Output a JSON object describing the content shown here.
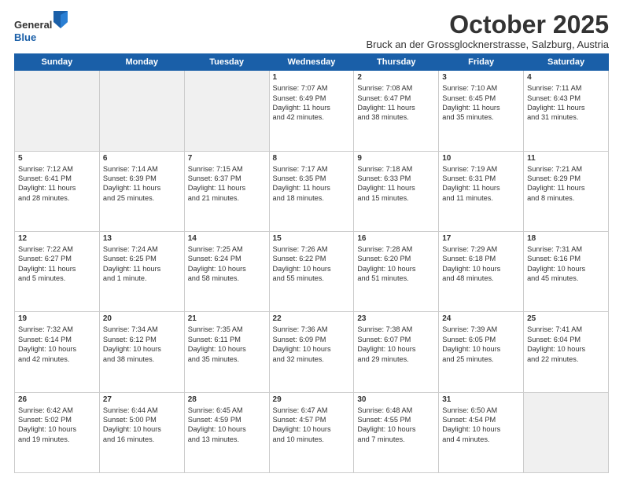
{
  "header": {
    "logo_line1": "General",
    "logo_line2": "Blue",
    "month": "October 2025",
    "location": "Bruck an der Grossglocknerstrasse, Salzburg, Austria"
  },
  "weekdays": [
    "Sunday",
    "Monday",
    "Tuesday",
    "Wednesday",
    "Thursday",
    "Friday",
    "Saturday"
  ],
  "rows": [
    [
      {
        "day": "",
        "info": "",
        "shaded": true
      },
      {
        "day": "",
        "info": "",
        "shaded": true
      },
      {
        "day": "",
        "info": "",
        "shaded": true
      },
      {
        "day": "1",
        "info": "Sunrise: 7:07 AM\nSunset: 6:49 PM\nDaylight: 11 hours\nand 42 minutes."
      },
      {
        "day": "2",
        "info": "Sunrise: 7:08 AM\nSunset: 6:47 PM\nDaylight: 11 hours\nand 38 minutes."
      },
      {
        "day": "3",
        "info": "Sunrise: 7:10 AM\nSunset: 6:45 PM\nDaylight: 11 hours\nand 35 minutes."
      },
      {
        "day": "4",
        "info": "Sunrise: 7:11 AM\nSunset: 6:43 PM\nDaylight: 11 hours\nand 31 minutes."
      }
    ],
    [
      {
        "day": "5",
        "info": "Sunrise: 7:12 AM\nSunset: 6:41 PM\nDaylight: 11 hours\nand 28 minutes."
      },
      {
        "day": "6",
        "info": "Sunrise: 7:14 AM\nSunset: 6:39 PM\nDaylight: 11 hours\nand 25 minutes."
      },
      {
        "day": "7",
        "info": "Sunrise: 7:15 AM\nSunset: 6:37 PM\nDaylight: 11 hours\nand 21 minutes."
      },
      {
        "day": "8",
        "info": "Sunrise: 7:17 AM\nSunset: 6:35 PM\nDaylight: 11 hours\nand 18 minutes."
      },
      {
        "day": "9",
        "info": "Sunrise: 7:18 AM\nSunset: 6:33 PM\nDaylight: 11 hours\nand 15 minutes."
      },
      {
        "day": "10",
        "info": "Sunrise: 7:19 AM\nSunset: 6:31 PM\nDaylight: 11 hours\nand 11 minutes."
      },
      {
        "day": "11",
        "info": "Sunrise: 7:21 AM\nSunset: 6:29 PM\nDaylight: 11 hours\nand 8 minutes."
      }
    ],
    [
      {
        "day": "12",
        "info": "Sunrise: 7:22 AM\nSunset: 6:27 PM\nDaylight: 11 hours\nand 5 minutes."
      },
      {
        "day": "13",
        "info": "Sunrise: 7:24 AM\nSunset: 6:25 PM\nDaylight: 11 hours\nand 1 minute."
      },
      {
        "day": "14",
        "info": "Sunrise: 7:25 AM\nSunset: 6:24 PM\nDaylight: 10 hours\nand 58 minutes."
      },
      {
        "day": "15",
        "info": "Sunrise: 7:26 AM\nSunset: 6:22 PM\nDaylight: 10 hours\nand 55 minutes."
      },
      {
        "day": "16",
        "info": "Sunrise: 7:28 AM\nSunset: 6:20 PM\nDaylight: 10 hours\nand 51 minutes."
      },
      {
        "day": "17",
        "info": "Sunrise: 7:29 AM\nSunset: 6:18 PM\nDaylight: 10 hours\nand 48 minutes."
      },
      {
        "day": "18",
        "info": "Sunrise: 7:31 AM\nSunset: 6:16 PM\nDaylight: 10 hours\nand 45 minutes."
      }
    ],
    [
      {
        "day": "19",
        "info": "Sunrise: 7:32 AM\nSunset: 6:14 PM\nDaylight: 10 hours\nand 42 minutes."
      },
      {
        "day": "20",
        "info": "Sunrise: 7:34 AM\nSunset: 6:12 PM\nDaylight: 10 hours\nand 38 minutes."
      },
      {
        "day": "21",
        "info": "Sunrise: 7:35 AM\nSunset: 6:11 PM\nDaylight: 10 hours\nand 35 minutes."
      },
      {
        "day": "22",
        "info": "Sunrise: 7:36 AM\nSunset: 6:09 PM\nDaylight: 10 hours\nand 32 minutes."
      },
      {
        "day": "23",
        "info": "Sunrise: 7:38 AM\nSunset: 6:07 PM\nDaylight: 10 hours\nand 29 minutes."
      },
      {
        "day": "24",
        "info": "Sunrise: 7:39 AM\nSunset: 6:05 PM\nDaylight: 10 hours\nand 25 minutes."
      },
      {
        "day": "25",
        "info": "Sunrise: 7:41 AM\nSunset: 6:04 PM\nDaylight: 10 hours\nand 22 minutes."
      }
    ],
    [
      {
        "day": "26",
        "info": "Sunrise: 6:42 AM\nSunset: 5:02 PM\nDaylight: 10 hours\nand 19 minutes."
      },
      {
        "day": "27",
        "info": "Sunrise: 6:44 AM\nSunset: 5:00 PM\nDaylight: 10 hours\nand 16 minutes."
      },
      {
        "day": "28",
        "info": "Sunrise: 6:45 AM\nSunset: 4:59 PM\nDaylight: 10 hours\nand 13 minutes."
      },
      {
        "day": "29",
        "info": "Sunrise: 6:47 AM\nSunset: 4:57 PM\nDaylight: 10 hours\nand 10 minutes."
      },
      {
        "day": "30",
        "info": "Sunrise: 6:48 AM\nSunset: 4:55 PM\nDaylight: 10 hours\nand 7 minutes."
      },
      {
        "day": "31",
        "info": "Sunrise: 6:50 AM\nSunset: 4:54 PM\nDaylight: 10 hours\nand 4 minutes."
      },
      {
        "day": "",
        "info": "",
        "shaded": true
      }
    ]
  ]
}
